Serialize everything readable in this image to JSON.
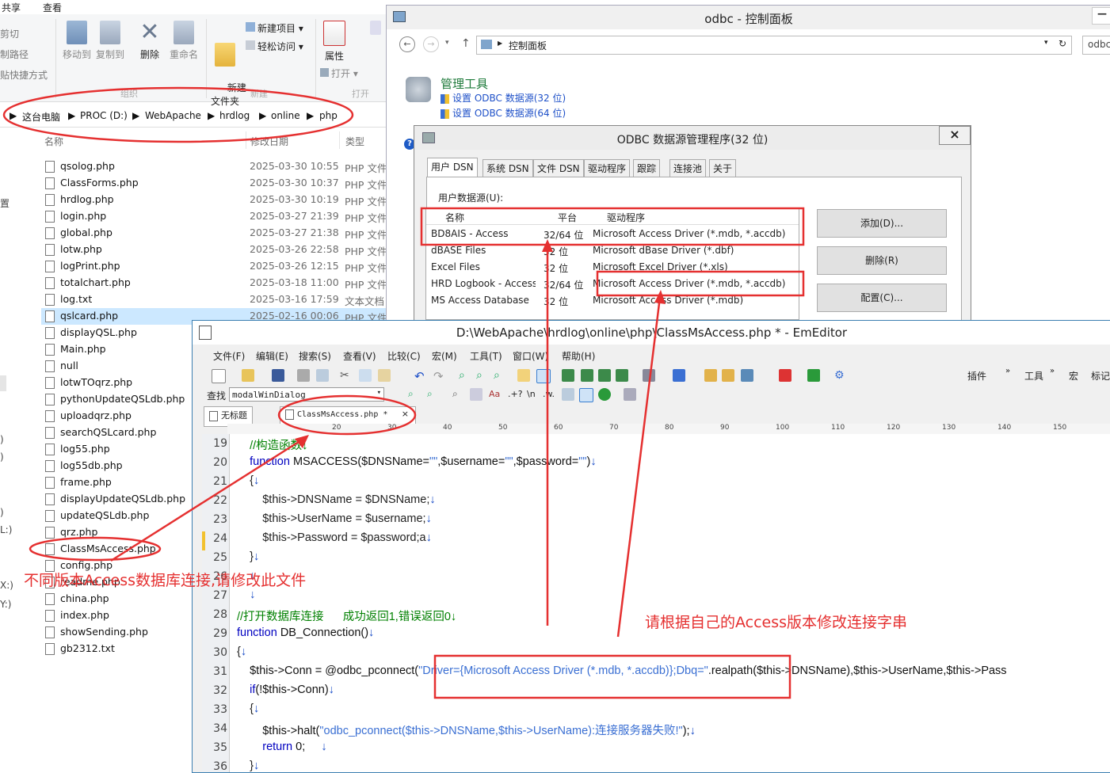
{
  "explorer": {
    "ribbon_tabs": [
      "共享",
      "查看"
    ],
    "left_cut_labels": [
      "剪切",
      "制路径",
      "贴快捷方式"
    ],
    "buttons": {
      "move_to": "移动到",
      "copy_to": "复制到",
      "delete": "删除",
      "rename": "重命名",
      "new_folder": "新建\n文件夹",
      "new_item": "新建项目",
      "easy_access": "轻松访问",
      "properties": "属性",
      "open": "打开"
    },
    "group_labels": {
      "organize": "组织",
      "new": "新建",
      "open": "打开"
    },
    "address": [
      "这台电脑",
      "PROC (D:)",
      "WebApache",
      "hrdlog",
      "online",
      "php"
    ],
    "columns": {
      "name": "名称",
      "date": "修改日期",
      "type": "类型"
    },
    "files": [
      {
        "name": "qsolog.php",
        "date": "2025-03-30 10:55",
        "type": "PHP 文件"
      },
      {
        "name": "ClassForms.php",
        "date": "2025-03-30 10:37",
        "type": "PHP 文件"
      },
      {
        "name": "hrdlog.php",
        "date": "2025-03-30 10:19",
        "type": "PHP 文件"
      },
      {
        "name": "login.php",
        "date": "2025-03-27 21:39",
        "type": "PHP 文件"
      },
      {
        "name": "global.php",
        "date": "2025-03-27 21:38",
        "type": "PHP 文件"
      },
      {
        "name": "lotw.php",
        "date": "2025-03-26 22:58",
        "type": "PHP 文件"
      },
      {
        "name": "logPrint.php",
        "date": "2025-03-26 12:15",
        "type": "PHP 文件"
      },
      {
        "name": "totalchart.php",
        "date": "2025-03-18 11:00",
        "type": "PHP 文件"
      },
      {
        "name": "log.txt",
        "date": "2025-03-16 17:59",
        "type": "文本文档"
      },
      {
        "name": "qslcard.php",
        "date": "2025-02-16 00:06",
        "type": "PHP 文件"
      },
      {
        "name": "displayQSL.php",
        "date": "",
        "type": ""
      },
      {
        "name": "Main.php",
        "date": "",
        "type": ""
      },
      {
        "name": "null",
        "date": "",
        "type": ""
      },
      {
        "name": "lotwTOqrz.php",
        "date": "",
        "type": ""
      },
      {
        "name": "pythonUpdateQSLdb.php",
        "date": "",
        "type": ""
      },
      {
        "name": "uploadqrz.php",
        "date": "",
        "type": ""
      },
      {
        "name": "searchQSLcard.php",
        "date": "",
        "type": ""
      },
      {
        "name": "log55.php",
        "date": "",
        "type": ""
      },
      {
        "name": "log55db.php",
        "date": "",
        "type": ""
      },
      {
        "name": "frame.php",
        "date": "",
        "type": ""
      },
      {
        "name": "displayUpdateQSLdb.php",
        "date": "",
        "type": ""
      },
      {
        "name": "updateQSLdb.php",
        "date": "",
        "type": ""
      },
      {
        "name": "qrz.php",
        "date": "",
        "type": ""
      },
      {
        "name": "ClassMsAccess.php",
        "date": "",
        "type": ""
      },
      {
        "name": "config.php",
        "date": "",
        "type": ""
      },
      {
        "name": "readme.php",
        "date": "",
        "type": ""
      },
      {
        "name": "china.php",
        "date": "",
        "type": ""
      },
      {
        "name": "index.php",
        "date": "",
        "type": ""
      },
      {
        "name": "showSending.php",
        "date": "",
        "type": ""
      },
      {
        "name": "gb2312.txt",
        "date": "",
        "type": ""
      }
    ]
  },
  "control_panel": {
    "title": "odbc - 控制面板",
    "breadcrumb": "控制面板",
    "search_placeholder": "odbc",
    "section_title": "管理工具",
    "link_32": "设置 ODBC 数据源(32 位)",
    "link_64": "设置 ODBC 数据源(64 位)"
  },
  "odbc_dialog": {
    "title": "ODBC 数据源管理程序(32 位)",
    "close": "×",
    "tabs": [
      "用户 DSN",
      "系统 DSN",
      "文件 DSN",
      "驱动程序",
      "跟踪",
      "连接池",
      "关于"
    ],
    "list_label": "用户数据源(U):",
    "headers": {
      "name": "名称",
      "platform": "平台",
      "driver": "驱动程序"
    },
    "rows": [
      {
        "name": "BD8AIS - Access",
        "platform": "32/64 位",
        "driver": "Microsoft Access Driver (*.mdb, *.accdb)"
      },
      {
        "name": "dBASE Files",
        "platform": "32 位",
        "driver": "Microsoft dBase Driver (*.dbf)"
      },
      {
        "name": "Excel Files",
        "platform": "32 位",
        "driver": "Microsoft Excel Driver (*.xls)"
      },
      {
        "name": "HRD Logbook - Access",
        "platform": "32/64 位",
        "driver": "Microsoft Access Driver (*.mdb, *.accdb)"
      },
      {
        "name": "MS Access Database",
        "platform": "32 位",
        "driver": "Microsoft Access Driver (*.mdb)"
      }
    ],
    "buttons": {
      "add": "添加(D)...",
      "remove": "删除(R)",
      "configure": "配置(C)..."
    }
  },
  "emeditor": {
    "title": "D:\\WebApache\\hrdlog\\online\\php\\ClassMsAccess.php * - EmEditor",
    "menu": [
      "文件(F)",
      "编辑(E)",
      "搜索(S)",
      "查看(V)",
      "比较(C)",
      "宏(M)",
      "工具(T)",
      "窗口(W)",
      "帮助(H)"
    ],
    "toolbar_right": [
      "插件",
      "工具",
      "宏",
      "标记"
    ],
    "find_label": "查找",
    "find_value": "modalWinDialog",
    "doc_tabs": [
      "无标题",
      "ClassMsAccess.php *"
    ],
    "ruler_marks": [
      "20",
      "30",
      "40",
      "50",
      "60",
      "70",
      "80",
      "90",
      "100",
      "110",
      "120",
      "130",
      "140",
      "150"
    ],
    "lines": [
      {
        "n": "19",
        "t": "    //构造函数↓"
      },
      {
        "n": "20",
        "t": "    function MSACCESS($DNSName=\"\",$username=\"\",$password=\"\")↓"
      },
      {
        "n": "21",
        "t": "    {↓"
      },
      {
        "n": "22",
        "t": "        $this->DNSName = $DNSName;↓"
      },
      {
        "n": "23",
        "t": "        $this->UserName = $username;↓"
      },
      {
        "n": "24",
        "t": "        $this->Password = $password;a↓"
      },
      {
        "n": "25",
        "t": "    }↓"
      },
      {
        "n": "26",
        "t": "    ↓"
      },
      {
        "n": "27",
        "t": "    ↓"
      },
      {
        "n": "28",
        "t": "//打开数据库连接      成功返回1,错误返回0↓"
      },
      {
        "n": "29",
        "t": "function DB_Connection()↓"
      },
      {
        "n": "30",
        "t": "{↓"
      },
      {
        "n": "31",
        "t": "    $this->Conn = @odbc_pconnect(\"Driver={Microsoft Access Driver (*.mdb, *.accdb)};Dbq=\".realpath($this->DNSName),$this->UserName,$this->Pass"
      },
      {
        "n": "32",
        "t": "    if(!$this->Conn)↓"
      },
      {
        "n": "33",
        "t": "    {↓"
      },
      {
        "n": "34",
        "t": "        $this->halt(\"odbc_pconnect($this->DNSName,$this->UserName):连接服务器失败!\");↓"
      },
      {
        "n": "35",
        "t": "        return 0;     ↓"
      },
      {
        "n": "36",
        "t": "    }↓"
      }
    ]
  },
  "annotations": {
    "left_note": "不同版本Access数据库连接,请修改此文件",
    "right_note": "请根据自己的Access版本修改连接字串",
    "color": "#e53030"
  }
}
